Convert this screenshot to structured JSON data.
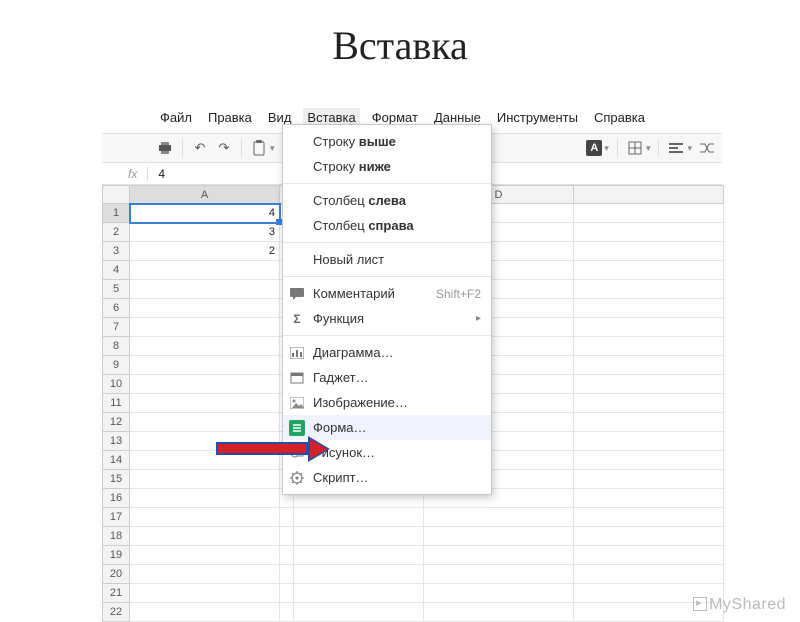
{
  "slide": {
    "title": "Вставка"
  },
  "menubar": {
    "items": [
      "Файл",
      "Правка",
      "Вид",
      "Вставка",
      "Формат",
      "Данные",
      "Инструменты",
      "Справка"
    ],
    "active_index": 3
  },
  "formula_bar": {
    "label": "fx",
    "value": "4"
  },
  "columns": [
    "A",
    "",
    "",
    "D"
  ],
  "rows": [
    "1",
    "2",
    "3",
    "4",
    "5",
    "6",
    "7",
    "8",
    "9",
    "10",
    "11",
    "12",
    "13",
    "14",
    "15",
    "16",
    "17",
    "18",
    "19",
    "20",
    "21",
    "22"
  ],
  "cells": {
    "A1": "4",
    "A2": "3",
    "A3": "2"
  },
  "active_cell": "A1",
  "menu": {
    "sections": [
      [
        {
          "label": "Строку выше"
        },
        {
          "label": "Строку ниже"
        }
      ],
      [
        {
          "label": "Столбец слева"
        },
        {
          "label": "Столбец справа"
        }
      ],
      [
        {
          "label": "Новый лист"
        }
      ],
      [
        {
          "label": "Комментарий",
          "icon": "comment",
          "shortcut": "Shift+F2"
        },
        {
          "label": "Функция",
          "icon": "sigma",
          "submenu": true
        }
      ],
      [
        {
          "label": "Диаграмма…",
          "icon": "chart"
        },
        {
          "label": "Гаджет…",
          "icon": "gadget"
        },
        {
          "label": "Изображение…",
          "icon": "image"
        },
        {
          "label": "Форма…",
          "icon": "form",
          "highlighted": true
        },
        {
          "label": "Рисунок…",
          "icon": "drawing"
        },
        {
          "label": "Скрипт…",
          "icon": "script"
        }
      ]
    ]
  },
  "watermark": {
    "brand": "MyShared"
  }
}
